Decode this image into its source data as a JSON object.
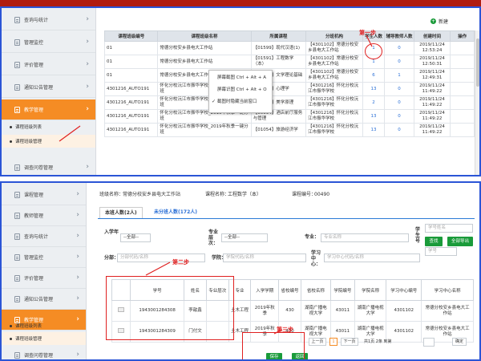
{
  "panel1": {
    "sidebar": [
      {
        "label": "查询与统计",
        "icon": "list-icon"
      },
      {
        "label": "管理监控",
        "icon": "monitor-icon"
      },
      {
        "label": "评价管理",
        "icon": "star-icon"
      },
      {
        "label": "通知公告管理",
        "icon": "notice-icon"
      },
      {
        "label": "教学管理",
        "icon": "book-icon"
      },
      {
        "label": "调查问卷管理",
        "icon": "survey-icon"
      }
    ],
    "sub_items": [
      {
        "label": "课程班级列表"
      },
      {
        "label": "课程班级管理"
      }
    ],
    "new_label": "新建",
    "columns": [
      "课程班级编号",
      "课程班级名称",
      "所属课程",
      "分班机构",
      "学生人数",
      "辅导教师人数",
      "创建时间",
      "操作"
    ],
    "rows": [
      {
        "code": "01",
        "name": "常德分校安乡县电大工作站",
        "course": "【01599】现代汉语(1)",
        "org": "【4301102】常德分校安乡县电大工作站",
        "students": "1",
        "teachers": "0",
        "created": "2019/11/24 12:53:24"
      },
      {
        "code": "01",
        "name": "常德分校安乡县电大工作站",
        "course": "【01591】工程数学（本）",
        "org": "【4301102】常德分校安乡县电大工作站",
        "students": "1",
        "teachers": "0",
        "created": "2019/11/24 12:50:31"
      },
      {
        "code": "01",
        "name": "常德分校安乡县电大工作站",
        "course": "【01597】文学理论基础",
        "org": "【4301102】常德分校安乡县电大工作站",
        "students": "6",
        "teachers": "1",
        "created": "2019/11/24 12:49:31"
      },
      {
        "code": "4301216_AUTO191",
        "name": "怀化分校沅江市振华学校_2019年秋季一键分班",
        "course": "【01667】心理学",
        "org": "【4301216】怀化分校沅江市振华学校",
        "students": "13",
        "teachers": "0",
        "created": "2019/11/24 11:49:22"
      },
      {
        "code": "4301216_AUTO191",
        "name": "怀化分校沅江市振华学校_2019年秋季一键分班",
        "course": "【00886】美学原理",
        "org": "【4301216】怀化分校沅江市振华学校",
        "students": "2",
        "teachers": "0",
        "created": "2019/11/24 11:49:22"
      },
      {
        "code": "4301216_AUTO191",
        "name": "怀化分校沅江市振华学校_2019年秋季一键分班",
        "course": "【00994】酒店前厅服务与管理",
        "org": "【4301216】怀化分校沅江市振华学校",
        "students": "13",
        "teachers": "0",
        "created": "2019/11/24 11:49:22"
      },
      {
        "code": "4301216_AUTO191",
        "name": "怀化分校沅江市振华学校_2019年秋季一键分班",
        "course": "【01054】旅游经济学",
        "org": "【4301216】怀化分校沅江市振华学校",
        "students": "13",
        "teachers": "0",
        "created": "2019/11/24 11:49:22"
      }
    ],
    "context_menu": [
      "屏幕截图 Ctrl + Alt + A",
      "屏幕识图 Ctrl + Alt + O",
      "截图时隐藏当前窗口"
    ],
    "step1": "第一步"
  },
  "panel2": {
    "sidebar": [
      {
        "label": "课程管理"
      },
      {
        "label": "教师管理"
      },
      {
        "label": "查询与统计"
      },
      {
        "label": "管理监控"
      },
      {
        "label": "评价管理"
      },
      {
        "label": "通知公告管理"
      },
      {
        "label": "教学管理"
      },
      {
        "label": "调查问卷管理"
      }
    ],
    "sub_items": [
      {
        "label": "课程班级列表"
      },
      {
        "label": "课程班级管理"
      }
    ],
    "info": {
      "class_label": "班级名称：",
      "class_value": "常德分校安乡县电大工作站",
      "course_label": "课程名称：",
      "course_value": "工程数学（本）",
      "code_label": "课程编号：",
      "code_value": "00490"
    },
    "tabs": [
      "本班人数(2人)",
      "未分班人数(172人)"
    ],
    "filters": {
      "year_label": "入学年",
      "year_value": "--全部--",
      "level_label": "专业层次：",
      "level_value": "--全部--",
      "major_label": "专业：",
      "major_ph": "专业名称",
      "stuno_label": "学生号",
      "stuno_ph": "学号",
      "name_ph": "学号姓名",
      "branch_label": "分部：",
      "branch_ph": "分部代码/名称",
      "school_label": "学院：",
      "school_ph": "学院代码/名称",
      "center_label": "学习中心：",
      "center_ph": "学习中心代码/名称",
      "query": "查找",
      "export": "全部导出"
    },
    "columns": [
      "",
      "学号",
      "姓名",
      "专业层次",
      "专业",
      "入学学期",
      "省校编号",
      "省校名称",
      "学院编号",
      "学院名称",
      "学习中心编号",
      "学习中心名称"
    ],
    "rows": [
      {
        "id": "1943001284308",
        "name": "李歆鑫",
        "level": "",
        "major": "土木工程",
        "term": "2019年秋季",
        "prov_code": "430",
        "prov_name": "湖南广播电视大学",
        "col_code": "43011",
        "col_name": "湖南广播电视大学",
        "center_code": "4301102",
        "center_name": "常德分校安乡县电大工作站"
      },
      {
        "id": "1943001284309",
        "name": "门付文",
        "level": "",
        "major": "土木工程",
        "term": "2019年秋季",
        "prov_code": "430",
        "prov_name": "湖南广播电视大学",
        "col_code": "43011",
        "col_name": "湖南广播电视大学",
        "center_code": "4301102",
        "center_name": "常德分校安乡县电大工作站"
      }
    ],
    "pager": {
      "prev": "上一页",
      "page": "1",
      "next": "下一页",
      "summary": "共1页 2条 到第",
      "go": "确定"
    },
    "save": "保存",
    "back": "返回",
    "step2": "第二步",
    "step3": "第三步"
  }
}
